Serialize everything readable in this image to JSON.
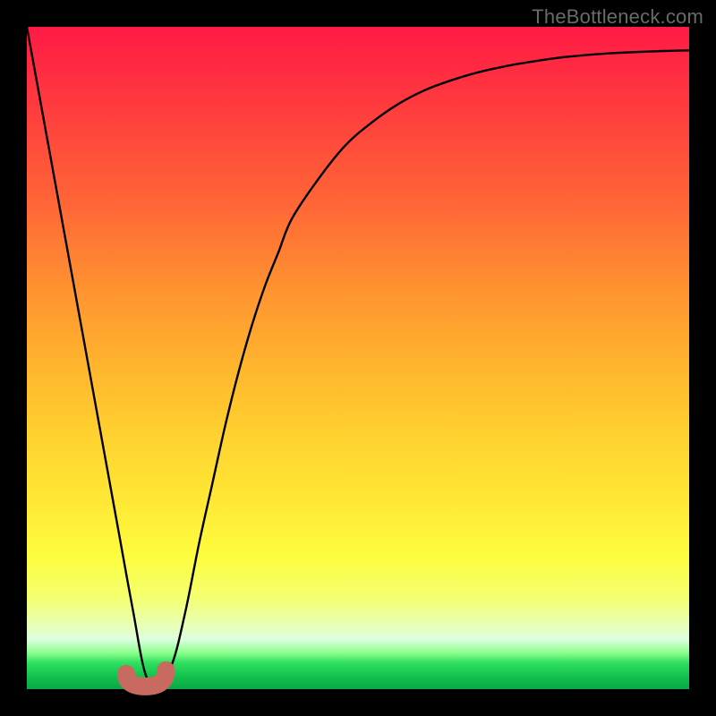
{
  "watermark": "TheBottleneck.com",
  "colors": {
    "page_bg": "#000000",
    "curve": "#000000",
    "blob": "#c86a60",
    "watermark": "#6a6a6a",
    "gradient_top": "#ff1a45",
    "gradient_mid": "#fdfd3f",
    "gradient_bottom": "#0aa846"
  },
  "chart_data": {
    "type": "line",
    "title": "",
    "xlabel": "",
    "ylabel": "",
    "xlim": [
      0,
      100
    ],
    "ylim": [
      0,
      100
    ],
    "grid": false,
    "legend": false,
    "annotations": [
      {
        "type": "highlight_region",
        "x0": 15,
        "x1": 21,
        "y": 1.5,
        "color": "#c86a60"
      }
    ],
    "series": [
      {
        "name": "bottleneck_curve",
        "x": [
          0,
          2,
          4,
          6,
          8,
          10,
          12,
          14,
          16,
          18,
          20,
          22,
          24,
          26,
          28,
          30,
          32,
          34,
          36,
          38,
          40,
          44,
          48,
          52,
          56,
          60,
          64,
          68,
          72,
          76,
          80,
          84,
          88,
          92,
          96,
          100
        ],
        "values": [
          100,
          89,
          78,
          67,
          56,
          45,
          34,
          23,
          12,
          2,
          1,
          4,
          12,
          22,
          31,
          40,
          48,
          55,
          61,
          66,
          71,
          77,
          82,
          85.5,
          88.3,
          90.4,
          91.9,
          93.1,
          94.0,
          94.7,
          95.3,
          95.7,
          96.0,
          96.2,
          96.35,
          96.45
        ]
      }
    ]
  }
}
